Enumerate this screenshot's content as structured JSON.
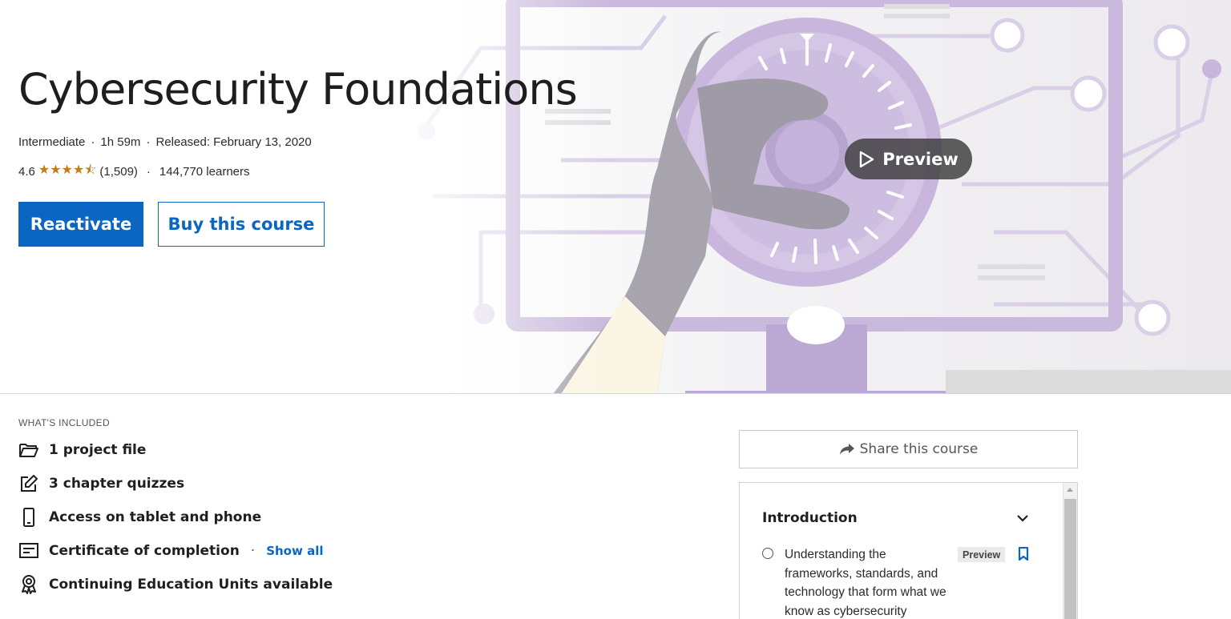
{
  "course": {
    "title": "Cybersecurity Foundations",
    "level": "Intermediate",
    "duration": "1h 59m",
    "released": "Released: February 13, 2020",
    "rating": "4.6",
    "rating_value": 4.6,
    "stars_glyph": "★★★★⯪",
    "rating_count": "(1,509)",
    "learners": "144,770 learners",
    "separator": "·"
  },
  "actions": {
    "primary_label": "Reactivate",
    "secondary_label": "Buy this course",
    "preview_label": "Preview"
  },
  "included": {
    "heading": "WHAT'S INCLUDED",
    "items": [
      {
        "label": "1 project file",
        "icon": "folder-icon"
      },
      {
        "label": "3 chapter quizzes",
        "icon": "edit-icon"
      },
      {
        "label": "Access on tablet and phone",
        "icon": "phone-icon"
      },
      {
        "label": "Certificate of completion",
        "icon": "certificate-icon"
      },
      {
        "label": "Continuing Education Units available",
        "icon": "award-icon"
      }
    ],
    "show_all": "Show all"
  },
  "share": {
    "label": "Share this course",
    "icon": "share-icon"
  },
  "toc": {
    "chapter": "Introduction",
    "lesson": {
      "title": "Understanding the frameworks, standards, and technology that form what we know as cybersecurity",
      "tag": "Preview"
    }
  },
  "colors": {
    "brand": "#0a66c2",
    "star": "#c37d16",
    "art_purple": "#b7a6cc"
  }
}
